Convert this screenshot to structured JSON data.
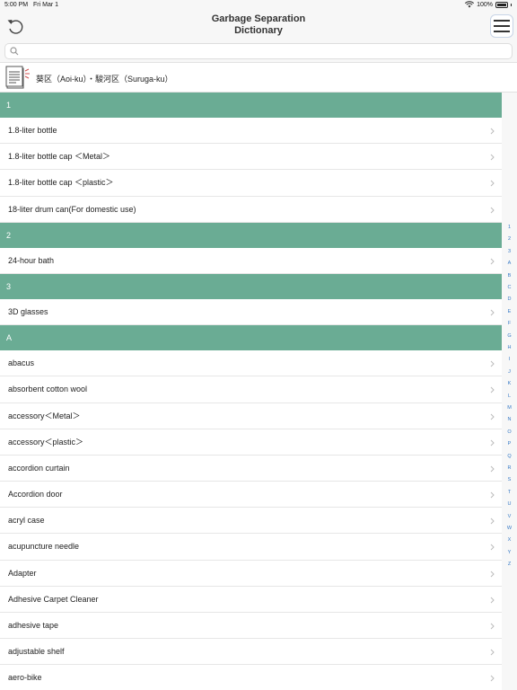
{
  "status_bar": {
    "time": "5:00 PM",
    "date": "Fri Mar 1",
    "battery": "100%",
    "wifi_icon": "wifi-icon",
    "battery_icon": "battery-icon"
  },
  "header": {
    "title_line1": "Garbage Separation",
    "title_line2": "Dictionary",
    "refresh_icon": "refresh-icon",
    "menu_icon": "hamburger-menu-icon"
  },
  "search": {
    "placeholder": "",
    "value": "",
    "icon": "search-icon"
  },
  "region": {
    "label": "葵区（Aoi-ku）・駿河区（Suruga-ku）",
    "icon": "document-icon"
  },
  "sections": [
    {
      "header": "1",
      "items": [
        "1.8-liter bottle",
        "1.8-liter bottle cap ＜Metal＞",
        "1.8-liter bottle cap ＜plastic＞",
        "18-liter drum can(For domestic use)"
      ]
    },
    {
      "header": "2",
      "items": [
        "24-hour bath"
      ]
    },
    {
      "header": "3",
      "items": [
        "3D glasses"
      ]
    },
    {
      "header": "A",
      "items": [
        "abacus",
        "absorbent cotton wool",
        "accessory＜Metal＞",
        "accessory＜plastic＞",
        "accordion curtain",
        "Accordion door",
        "acryl case",
        "acupuncture needle",
        "Adapter",
        "Adhesive Carpet Cleaner",
        "adhesive tape",
        "adjustable shelf",
        "aero-bike"
      ]
    }
  ],
  "index": [
    "1",
    "2",
    "3",
    "A",
    "B",
    "C",
    "D",
    "E",
    "F",
    "G",
    "H",
    "I",
    "J",
    "K",
    "L",
    "M",
    "N",
    "O",
    "P",
    "Q",
    "R",
    "S",
    "T",
    "U",
    "V",
    "W",
    "X",
    "Y",
    "Z"
  ],
  "colors": {
    "section_header": "#6aac94",
    "index_text": "#3478c6",
    "bar_bg": "#f7f7f7"
  }
}
